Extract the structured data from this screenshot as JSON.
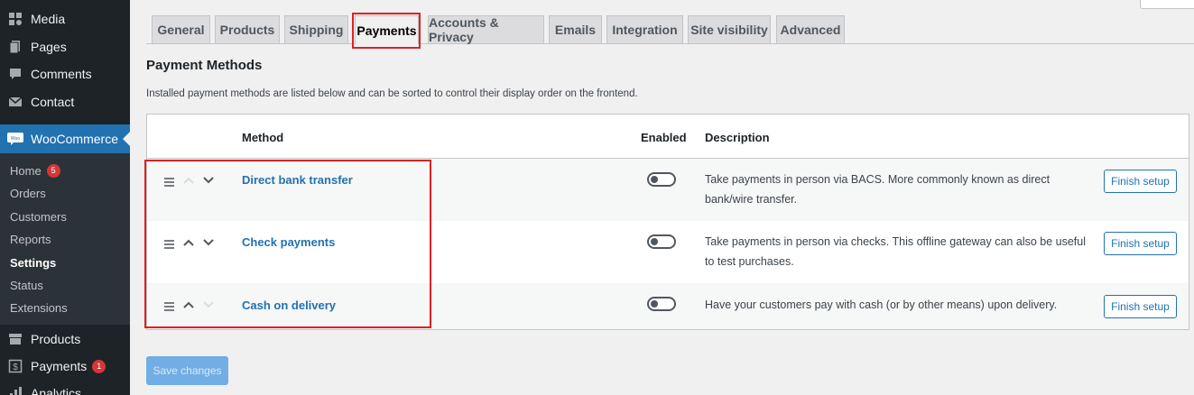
{
  "sidebar": {
    "top_items": [
      {
        "label": "Media",
        "icon": "media-icon"
      },
      {
        "label": "Pages",
        "icon": "pages-icon"
      },
      {
        "label": "Comments",
        "icon": "comments-icon"
      },
      {
        "label": "Contact",
        "icon": "mail-icon"
      }
    ],
    "woocommerce": {
      "label": "WooCommerce",
      "icon": "woocommerce-icon"
    },
    "submenu": [
      {
        "label": "Home",
        "badge": "5"
      },
      {
        "label": "Orders"
      },
      {
        "label": "Customers"
      },
      {
        "label": "Reports"
      },
      {
        "label": "Settings"
      },
      {
        "label": "Status"
      },
      {
        "label": "Extensions"
      }
    ],
    "bottom_items": [
      {
        "label": "Products",
        "icon": "products-icon"
      },
      {
        "label": "Payments",
        "icon": "payments-icon",
        "badge": "1"
      },
      {
        "label": "Analytics",
        "icon": "analytics-icon"
      }
    ]
  },
  "tabs": [
    "General",
    "Products",
    "Shipping",
    "Payments",
    "Accounts & Privacy",
    "Emails",
    "Integration",
    "Site visibility",
    "Advanced"
  ],
  "active_tab": "Payments",
  "section_title": "Payment Methods",
  "intro": "Installed payment methods are listed below and can be sorted to control their display order on the frontend.",
  "table": {
    "headers": {
      "method": "Method",
      "enabled": "Enabled",
      "description": "Description"
    },
    "rows": [
      {
        "method": "Direct bank transfer",
        "enabled": false,
        "description": "Take payments in person via BACS. More commonly known as direct bank/wire transfer.",
        "action": "Finish setup"
      },
      {
        "method": "Check payments",
        "enabled": false,
        "description": "Take payments in person via checks. This offline gateway can also be useful to test purchases.",
        "action": "Finish setup"
      },
      {
        "method": "Cash on delivery",
        "enabled": false,
        "description": "Have your customers pay with cash (or by other means) upon delivery.",
        "action": "Finish setup"
      }
    ]
  },
  "save_button": "Save changes",
  "colors": {
    "accent": "#2271b1",
    "sidebar": "#1d2327",
    "highlight": "#e02020",
    "badge": "#d63638"
  }
}
